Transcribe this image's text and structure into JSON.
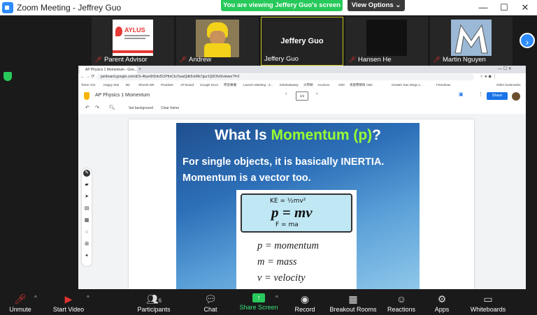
{
  "window": {
    "title": "Zoom Meeting - Jeffrey Guo",
    "minimize": "—",
    "maximize": "☐",
    "close": "✕"
  },
  "banner": {
    "text": "You are viewing Jeffery Guo's screen",
    "view_options": "View Options ⌄"
  },
  "participants_strip": [
    {
      "name": "Parent Advisor",
      "muted": true,
      "tile_text": "AYLUS"
    },
    {
      "name": "Andrew",
      "muted": true
    },
    {
      "name": "Jeffery Guo",
      "muted": false,
      "active": true,
      "center_name": "Jeffery Guo"
    },
    {
      "name": "Hansen He",
      "muted": true
    },
    {
      "name": "Martin Nguyen",
      "muted": true
    }
  ],
  "browser": {
    "tab_title": "AP Physics 1 Momentum - Goo...",
    "url": "jamboard.google.com/d/1t-4bye6hDdx5CiPfmCtuTsaeQdk5vbNk7gur1Q0Ofv0/viewer?f=2",
    "bookmarks": [
      "Tarrer Ore",
      "Happy Star",
      "BC",
      "Shreek WK",
      "Peanbek",
      "AP Board",
      "Google Docs",
      "學習專欄",
      "Launch Meeting - Z...",
      "EdmDataway",
      "大學網",
      "Auctions",
      "CBC",
      "青歌賽節目 CBC",
      "Greater San Diego L...",
      "Freedman",
      "Other bookmarks"
    ]
  },
  "jamboard": {
    "title": "AP Physics 1 Momentum",
    "frame_indicator": "2/2",
    "share_label": "Share",
    "toolbar": {
      "set_background": "Set background",
      "clear_frame": "Clear frame"
    }
  },
  "slide": {
    "title_prefix": "What Is ",
    "title_highlight": "Momentum (p)",
    "title_suffix": "?",
    "line1": "For single objects, it is basically INERTIA.",
    "line2": "Momentum is a vector too.",
    "ke_note": "KE = ½mv²",
    "formula": "p = mv",
    "fma_note": "F = ma",
    "defs": [
      "p = momentum",
      "m = mass",
      "v = velocity"
    ]
  },
  "bottom_bar": {
    "unmute": "Unmute",
    "start_video": "Start Video",
    "participants": "Participants",
    "participants_count": "6",
    "chat": "Chat",
    "share_screen": "Share Screen",
    "record": "Record",
    "breakout_rooms": "Breakout Rooms",
    "reactions": "Reactions",
    "apps": "Apps",
    "whiteboards": "Whiteboards"
  },
  "colors": {
    "accent": "#2d8cff",
    "share_green": "#27c95a",
    "highlight": "#99ff33",
    "mute_red": "#e0332f"
  }
}
